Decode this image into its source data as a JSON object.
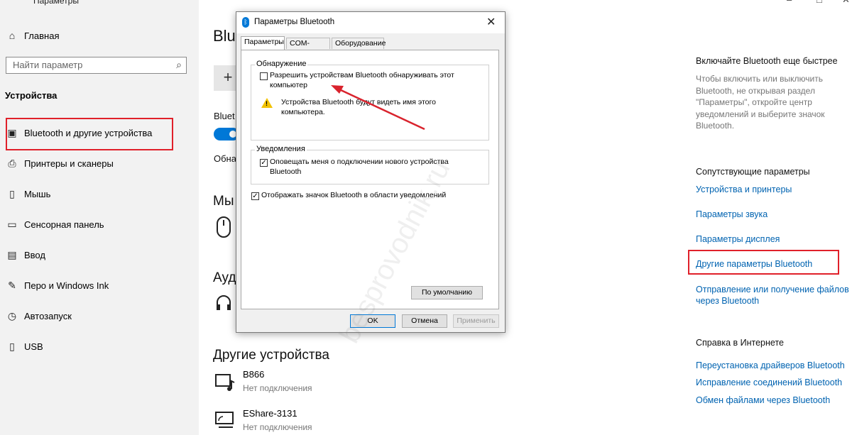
{
  "window": {
    "title": "Параметры",
    "controls": [
      "–",
      "□",
      "✕"
    ]
  },
  "sidebar": {
    "home": "Главная",
    "search_placeholder": "Найти параметр",
    "section": "Устройства",
    "items": [
      {
        "label": "Bluetooth и другие устройства",
        "icon": "bluetooth-devices-icon",
        "glyph": "▣"
      },
      {
        "label": "Принтеры и сканеры",
        "icon": "printer-icon",
        "glyph": "⎙"
      },
      {
        "label": "Мышь",
        "icon": "mouse-icon",
        "glyph": "▯"
      },
      {
        "label": "Сенсорная панель",
        "icon": "touchpad-icon",
        "glyph": "▭"
      },
      {
        "label": "Ввод",
        "icon": "keyboard-icon",
        "glyph": "▤"
      },
      {
        "label": "Перо и Windows Ink",
        "icon": "pen-icon",
        "glyph": "✎"
      },
      {
        "label": "Автозапуск",
        "icon": "autoplay-icon",
        "glyph": "◷"
      },
      {
        "label": "USB",
        "icon": "usb-icon",
        "glyph": "▯"
      }
    ]
  },
  "main": {
    "heading": "Blu",
    "add_glyph": "+",
    "bt_label": "Bluet",
    "discover_label": "Обна",
    "mouse_heading": "Мы",
    "audio_heading": "Ауд",
    "other_heading": "Другие устройства",
    "devices": [
      {
        "name": "B866",
        "status": "Нет подключения",
        "icon": "media-device-icon"
      },
      {
        "name": "EShare-3131",
        "status": "Нет подключения",
        "icon": "display-device-icon"
      }
    ]
  },
  "right": {
    "faster_heading": "Включайте Bluetooth еще быстрее",
    "faster_text": "Чтобы включить или выключить Bluetooth, не открывая раздел \"Параметры\", откройте центр уведомлений и выберите значок Bluetooth.",
    "related_heading": "Сопутствующие параметры",
    "related_links": [
      "Устройства и принтеры",
      "Параметры звука",
      "Параметры дисплея",
      "Другие параметры Bluetooth",
      "Отправление или получение файлов через Bluetooth"
    ],
    "help_heading": "Справка в Интернете",
    "help_links": [
      "Переустановка драйверов Bluetooth",
      "Исправление соединений Bluetooth",
      "Обмен файлами через Bluetooth"
    ]
  },
  "dialog": {
    "title": "Параметры Bluetooth",
    "tabs": [
      "Параметры",
      "COM-порты",
      "Оборудование"
    ],
    "discovery_group": "Обнаружение",
    "discovery_check_line1": "Разрешить устройствам Bluetooth обнаруживать этот",
    "discovery_check_line2": "компьютер",
    "discovery_checked": false,
    "warning_line1": "Устройства Bluetooth будут видеть имя этого",
    "warning_line2": "компьютера.",
    "notify_group": "Уведомления",
    "notify_check_line1": "Оповещать меня о подключении нового устройства",
    "notify_check_line2": "Bluetooth",
    "notify_checked": true,
    "tray_check": "Отображать значок Bluetooth в области уведомлений",
    "tray_checked": true,
    "defaults_button": "По умолчанию",
    "ok_button": "OK",
    "cancel_button": "Отмена",
    "apply_button": "Применить"
  },
  "watermark": "besprovodnik.ru",
  "colors": {
    "accent": "#0078d7",
    "link": "#0063b1",
    "highlight_box": "#e0202a",
    "arrow": "#d9232d"
  }
}
